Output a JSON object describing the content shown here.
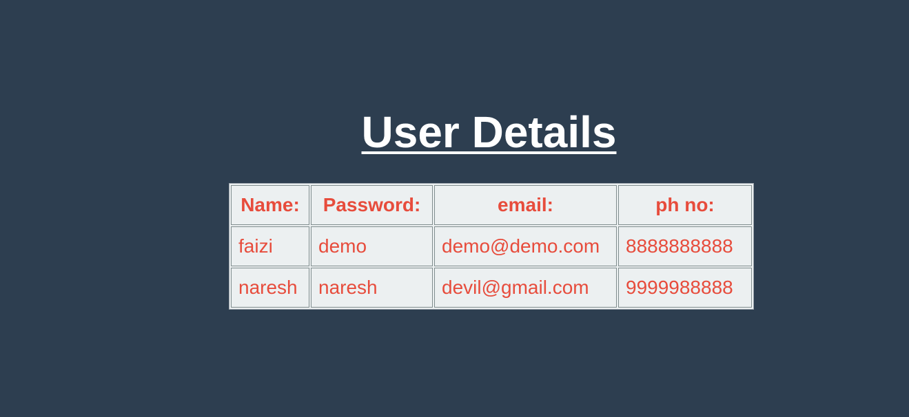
{
  "page": {
    "title": "User Details"
  },
  "table": {
    "headers": [
      "Name:",
      "Password:",
      "email:",
      "ph no:"
    ],
    "rows": [
      {
        "name": "faizi",
        "password": "demo",
        "email": "demo@demo.com",
        "phone": "8888888888"
      },
      {
        "name": "naresh",
        "password": "naresh",
        "email": "devil@gmail.com",
        "phone": "9999988888"
      }
    ]
  },
  "colors": {
    "background": "#2d3e50",
    "title": "#ffffff",
    "table_bg": "#ecf0f1",
    "text_accent": "#e74c3c"
  }
}
